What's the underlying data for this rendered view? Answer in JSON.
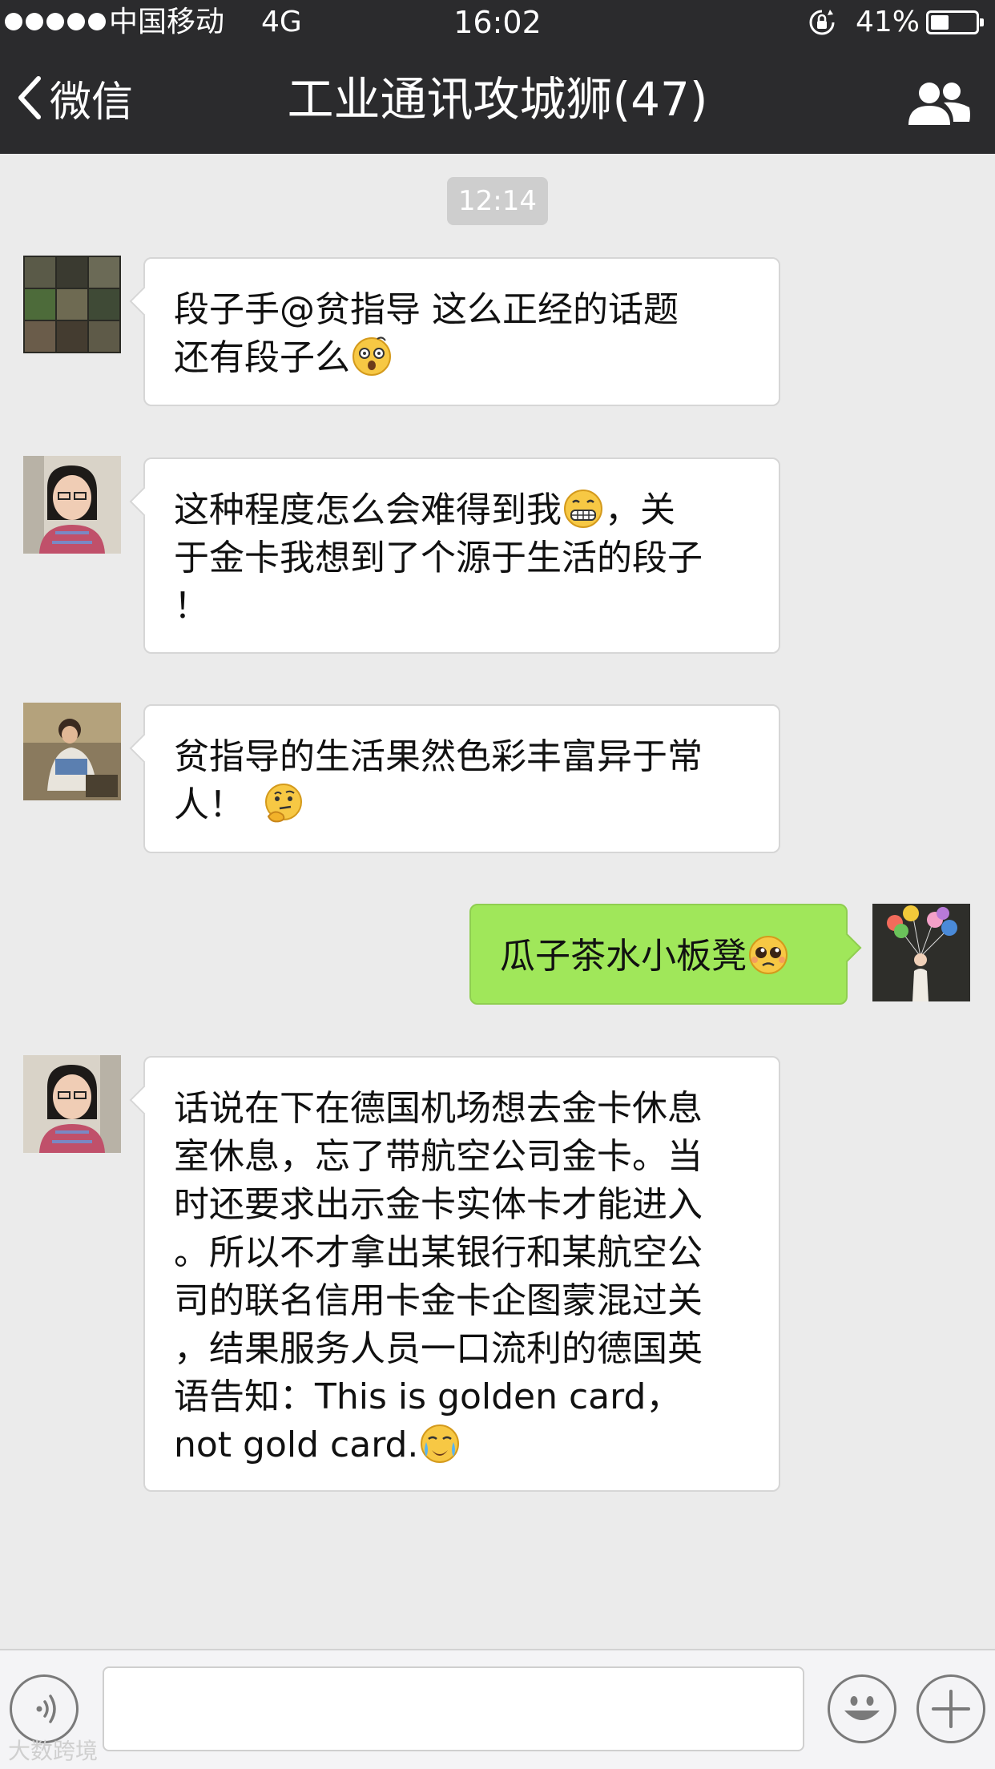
{
  "status_bar": {
    "carrier": "中国移动",
    "network": "4G",
    "time": "16:02",
    "battery": "41%",
    "battery_level": 0.41
  },
  "nav": {
    "back_label": "微信",
    "title": "工业通讯攻城狮(47)"
  },
  "chat": {
    "timestamp": "12:14",
    "messages": [
      {
        "side": "left",
        "lines": [
          "段子手@贫指导 这么正经的话题",
          "还有段子么"
        ],
        "emoji": "dizzy-face-emoji"
      },
      {
        "side": "left",
        "lines": [
          "这种程度怎么会难得到我",
          "于金卡我想到了个源于生活的段子",
          "！"
        ],
        "line1_suffix": "，关",
        "emoji": "grimacing-face-emoji"
      },
      {
        "side": "left",
        "lines": [
          "贫指导的生活果然色彩丰富异于常",
          "人！"
        ],
        "emoji": "thinking-face-emoji"
      },
      {
        "side": "right",
        "lines": [
          "瓜子茶水小板凳"
        ],
        "emoji": "pleading-face-emoji"
      },
      {
        "side": "left",
        "lines": [
          "话说在下在德国机场想去金卡休息",
          "室休息，忘了带航空公司金卡。当",
          "时还要求出示金卡实体卡才能进入",
          "。所以不才拿出某银行和某航空公",
          "司的联名信用卡金卡企图蒙混过关",
          "，结果服务人员一口流利的德国英",
          "语告知：This is golden card，",
          "not gold card."
        ],
        "emoji": "crying-face-emoji"
      }
    ]
  },
  "input_bar": {
    "text_value": ""
  },
  "watermark": "大数跨境",
  "colors": {
    "nav_bg": "#2b2b2d",
    "chat_bg": "#ebebeb",
    "bubble_mine": "#a0e75a",
    "bubble_other": "#ffffff"
  }
}
